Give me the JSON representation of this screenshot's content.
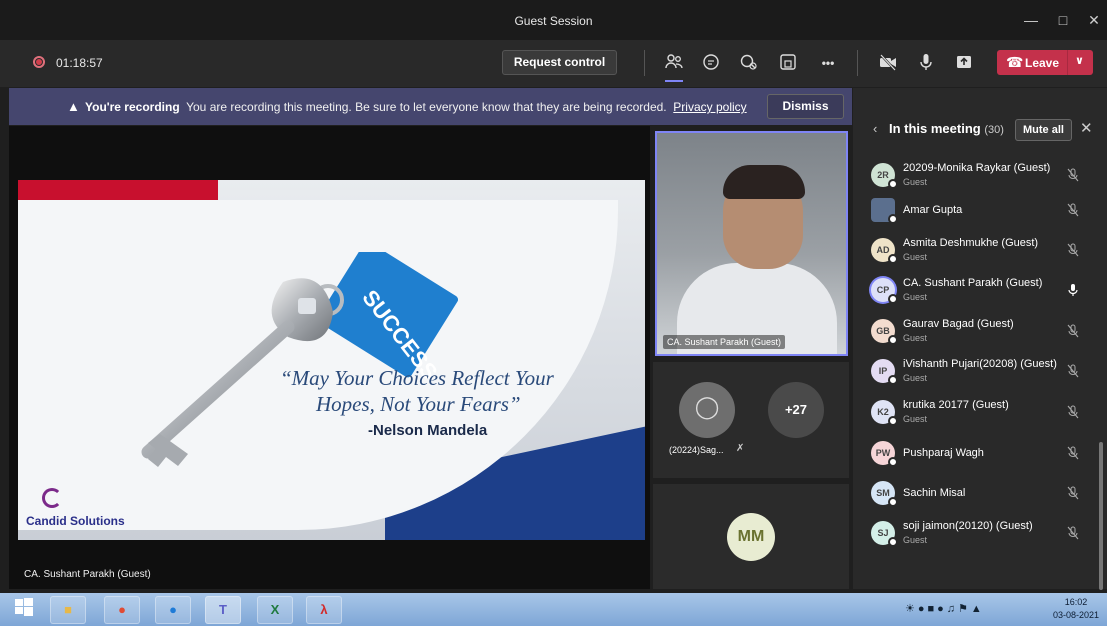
{
  "window": {
    "title": "Guest Session"
  },
  "toolbar": {
    "timer": "01:18:57",
    "request_control": "Request control",
    "leave": "Leave",
    "more": "•••"
  },
  "banner": {
    "bold": "You're recording",
    "text": "You are recording this meeting. Be sure to let everyone know that they are being recorded.",
    "link": "Privacy policy",
    "dismiss": "Dismiss"
  },
  "slide": {
    "tag": "SUCCESS",
    "quote_line1": "“May Your Choices Reflect Your",
    "quote_line2": "Hopes, Not Your Fears”",
    "author": "-Nelson Mandela",
    "logo": "Candid Solutions"
  },
  "stage": {
    "presenter": "CA. Sushant Parakh (Guest)"
  },
  "videos": {
    "main_name": "CA. Sushant Parakh (Guest)",
    "tile_name": "(20224)Sag...",
    "overflow": "+27",
    "mm_initials": "MM"
  },
  "panel": {
    "title": "In this meeting",
    "count": "(30)",
    "mute_all": "Mute all",
    "participants": [
      {
        "initials": "2R",
        "name": "20209-Monika Raykar (Guest)",
        "sub": "Guest",
        "color": "#cfe3d4"
      },
      {
        "initials": "",
        "name": "Amar Gupta",
        "sub": "",
        "color": "#5b6f8e"
      },
      {
        "initials": "AD",
        "name": "Asmita Deshmukhe (Guest)",
        "sub": "Guest",
        "color": "#efe3c8"
      },
      {
        "initials": "CP",
        "name": "CA. Sushant Parakh (Guest)",
        "sub": "Guest",
        "color": "#dde0f7"
      },
      {
        "initials": "GB",
        "name": "Gaurav Bagad (Guest)",
        "sub": "Guest",
        "color": "#f3dccf"
      },
      {
        "initials": "IP",
        "name": "iVishanth Pujari(20208) (Guest)",
        "sub": "Guest",
        "color": "#e4dcf3"
      },
      {
        "initials": "K2",
        "name": "krutika 20177 (Guest)",
        "sub": "Guest",
        "color": "#dfe3f5"
      },
      {
        "initials": "PW",
        "name": "Pushparaj Wagh",
        "sub": "",
        "color": "#f6d5d8"
      },
      {
        "initials": "SM",
        "name": "Sachin Misal",
        "sub": "",
        "color": "#d6e6f6"
      },
      {
        "initials": "SJ",
        "name": "soji jaimon(20120) (Guest)",
        "sub": "Guest",
        "color": "#d4efe8"
      }
    ]
  },
  "taskbar": {
    "time": "16:02",
    "date": "03-08-2021"
  }
}
